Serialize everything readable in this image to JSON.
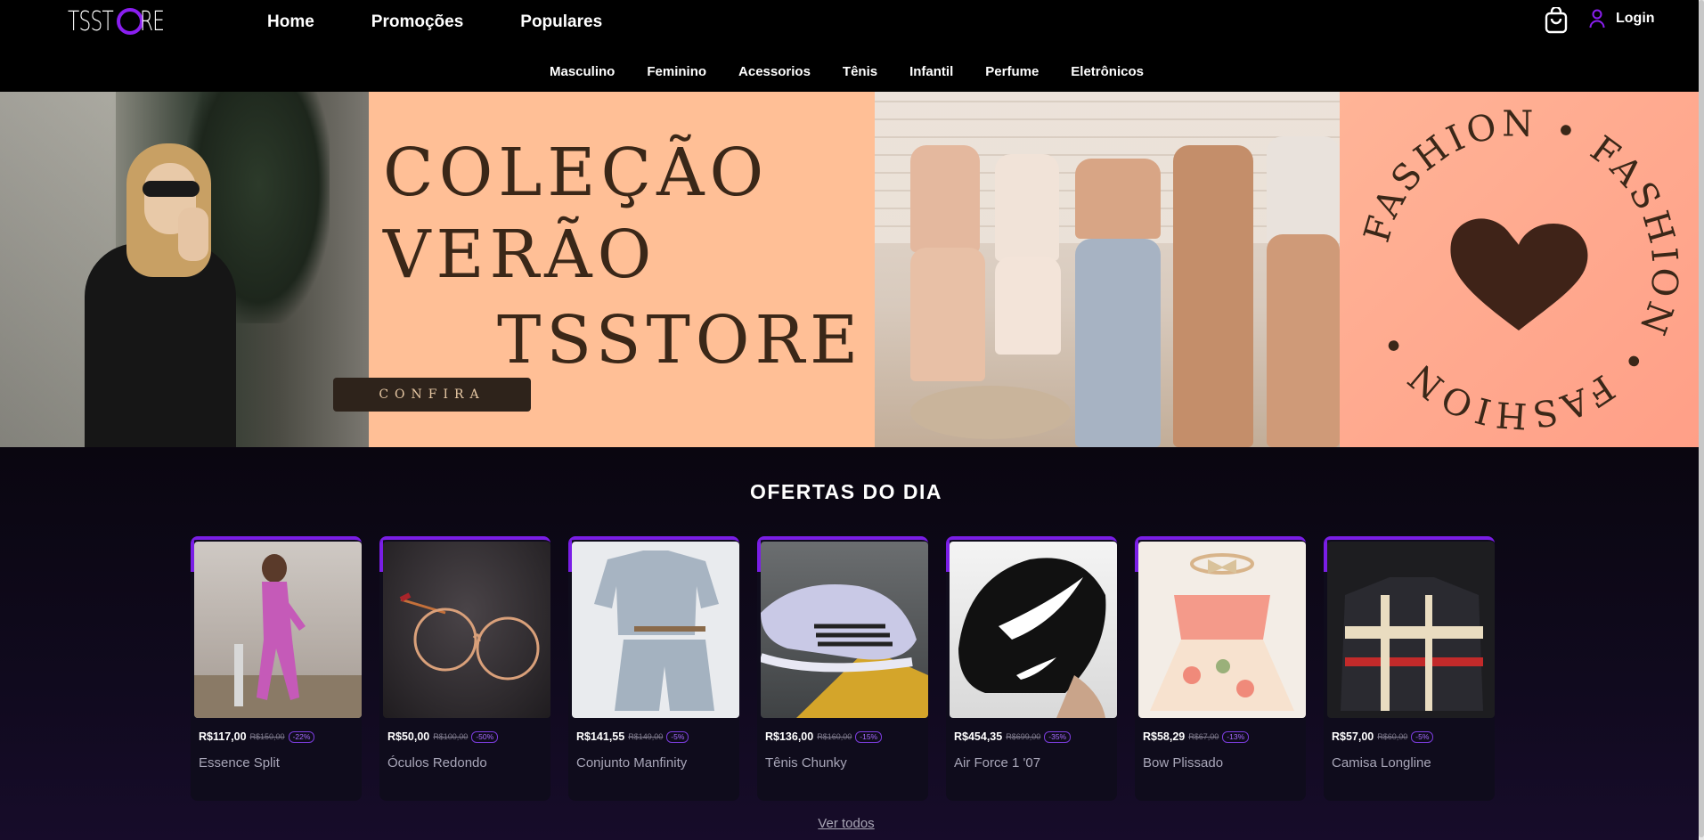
{
  "header": {
    "logo": {
      "left": "TSST",
      "right": "RE"
    },
    "nav": [
      "Home",
      "Promoções",
      "Populares"
    ],
    "categories": [
      "Masculino",
      "Feminino",
      "Acessorios",
      "Tênis",
      "Infantil",
      "Perfume",
      "Eletrônicos"
    ],
    "cart_icon": "shopping-bag-icon",
    "user_icon": "user-icon",
    "login_label": "Login",
    "accent_color": "#8a1ef0"
  },
  "banner": {
    "line1": "COLEÇÃO",
    "line2": "VERÃO",
    "line3": "TSSTORE",
    "cta": "CONFIRA",
    "ring_text": "FASHION • FASHION • FASHION •",
    "promo_color": "#ffbf96"
  },
  "offers": {
    "title": "OFERTAS DO DIA",
    "see_all": "Ver todos",
    "products": [
      {
        "price": "R$117,00",
        "old": "R$150,00",
        "discount": "-22%",
        "name": "Essence Split"
      },
      {
        "price": "R$50,00",
        "old": "R$100,00",
        "discount": "-50%",
        "name": "Óculos Redondo"
      },
      {
        "price": "R$141,55",
        "old": "R$149,00",
        "discount": "-5%",
        "name": "Conjunto Manfinity"
      },
      {
        "price": "R$136,00",
        "old": "R$160,00",
        "discount": "-15%",
        "name": "Tênis Chunky"
      },
      {
        "price": "R$454,35",
        "old": "R$699,00",
        "discount": "-35%",
        "name": "Air Force 1 '07"
      },
      {
        "price": "R$58,29",
        "old": "R$67,00",
        "discount": "-13%",
        "name": "Bow Plissado"
      },
      {
        "price": "R$57,00",
        "old": "R$60,00",
        "discount": "-5%",
        "name": "Camisa Longline"
      }
    ]
  }
}
